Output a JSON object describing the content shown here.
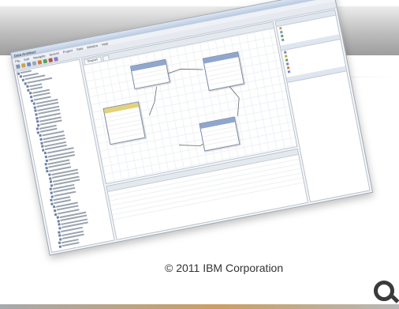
{
  "footer": {
    "copyright": "© 2011 IBM Corporation",
    "logo_icon": "ibm-rings-logo"
  },
  "colors": {
    "header_band": "#b5b5b5",
    "entity_blue": "#8fa6cf",
    "entity_yellow": "#e3d27a",
    "footer_accent": "#c9a063"
  },
  "app": {
    "title": "Data Architect",
    "menus": [
      "File",
      "Edit",
      "Navigate",
      "Search",
      "Project",
      "Data",
      "Window",
      "Help"
    ],
    "editor_tab": "Diagram"
  }
}
